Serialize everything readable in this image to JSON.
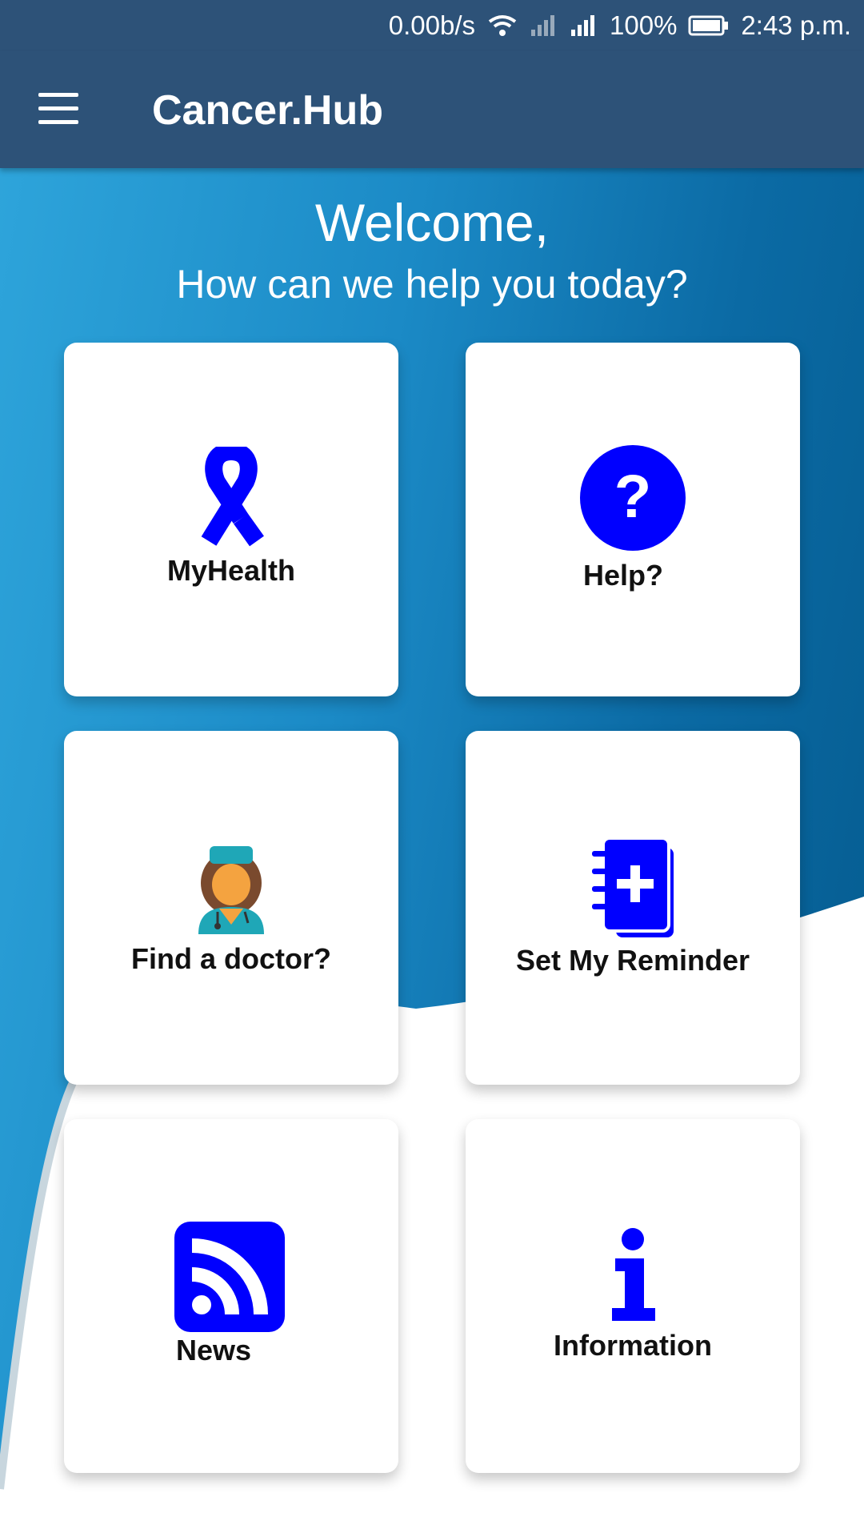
{
  "status_bar": {
    "speed": "0.00b/s",
    "battery": "100%",
    "time": "2:43 p.m."
  },
  "app_bar": {
    "title": "Cancer.Hub"
  },
  "header": {
    "welcome": "Welcome,",
    "subtitle": "How can we help you today?"
  },
  "tiles": [
    {
      "label": "MyHealth",
      "icon": "ribbon-icon"
    },
    {
      "label": "Help?",
      "icon": "question-circle-icon"
    },
    {
      "label": "Find a doctor?",
      "icon": "doctor-icon"
    },
    {
      "label": "Set My Reminder",
      "icon": "notebook-plus-icon"
    },
    {
      "label": "News",
      "icon": "rss-icon"
    },
    {
      "label": "Information",
      "icon": "info-icon"
    }
  ],
  "colors": {
    "app_bar": "#2d5278",
    "icon_blue": "#0000ff",
    "background_light": "#2fa6dc",
    "background_dark": "#045a8d"
  }
}
